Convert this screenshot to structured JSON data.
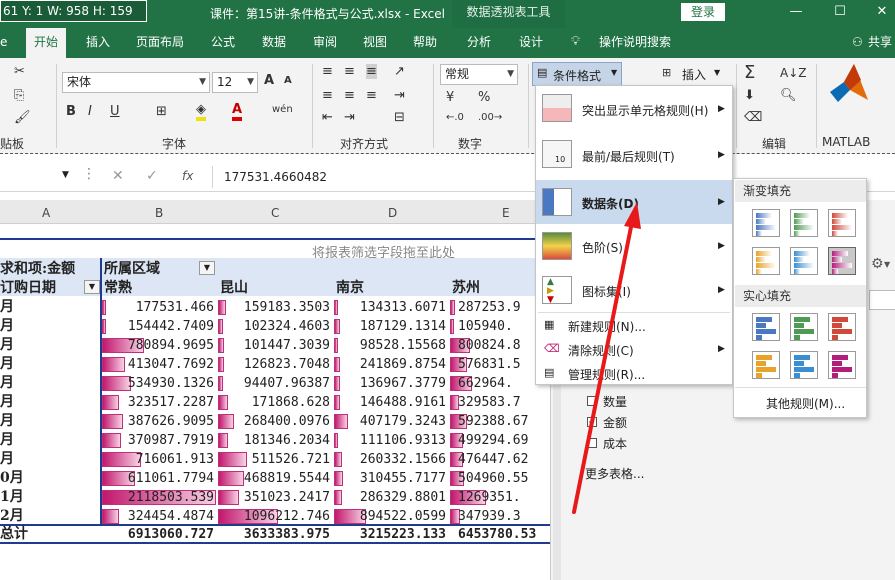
{
  "titlebar": {
    "coords": "61 Y: 1 W: 958 H: 159",
    "doc_title": "课件：第15讲-条件格式与公式.xlsx  -  Excel",
    "context_tools": "数据透视表工具",
    "login": "登录",
    "minimize": "—",
    "restore": "☐",
    "close": "✕"
  },
  "tabs": [
    "e",
    "开始",
    "插入",
    "页面布局",
    "公式",
    "数据",
    "审阅",
    "视图",
    "帮助",
    "分析",
    "设计",
    "操作说明搜索",
    "共享"
  ],
  "ribbon": {
    "font_name": "宋体",
    "font_size": "12",
    "number_format": "常规",
    "cond_format": "条件格式",
    "insert": "插入",
    "groups": [
      "贴板",
      "字体",
      "对齐方式",
      "数字",
      "编辑",
      "MATLAB"
    ],
    "bold": "B",
    "italic": "I",
    "underline": "U",
    "increase_font": "A",
    "decrease_font": "A",
    "wen": "wén",
    "percent": "%",
    "sum": "Σ",
    "matlab_label": "MATLAB"
  },
  "formula_bar": {
    "fx": "fx",
    "value": "177531.4660482"
  },
  "columns": [
    "A",
    "B",
    "C",
    "D",
    "E"
  ],
  "pivot": {
    "drop_hint": "将报表筛选字段拖至此处",
    "value_label": "求和项:金额",
    "col_field": "所属区域",
    "row_field": "订购日期",
    "regions": [
      "常熟",
      "昆山",
      "南京",
      "苏州"
    ],
    "rows": [
      {
        "label": "月",
        "values": [
          "177531.466",
          "159183.3503",
          "134313.6071",
          "287253.9"
        ]
      },
      {
        "label": "月",
        "values": [
          "154442.7409",
          "102324.4603",
          "187129.1314",
          "105940."
        ]
      },
      {
        "label": "月",
        "values": [
          "780894.9695",
          "101447.3039",
          "98528.15568",
          "800824.8"
        ]
      },
      {
        "label": "月",
        "values": [
          "413047.7692",
          "126823.7048",
          "241869.8754",
          "576831.5"
        ]
      },
      {
        "label": "月",
        "values": [
          "534930.1326",
          "94407.96387",
          "136967.3779",
          "662964."
        ]
      },
      {
        "label": "月",
        "values": [
          "323517.2287",
          "171868.628",
          "146488.9161",
          "329583.7"
        ]
      },
      {
        "label": "月",
        "values": [
          "387626.9095",
          "268400.0976",
          "407179.3243",
          "592388.67"
        ]
      },
      {
        "label": "月",
        "values": [
          "370987.7919",
          "181346.2034",
          "111106.9313",
          "499294.69"
        ]
      },
      {
        "label": "月",
        "values": [
          "716061.913",
          "511526.721",
          "260332.1566",
          "476447.62"
        ]
      },
      {
        "label": "0月",
        "values": [
          "611061.7794",
          "468819.5544",
          "310455.7177",
          "504960.55"
        ]
      },
      {
        "label": "1月",
        "values": [
          "2118503.539",
          "351023.2417",
          "286329.8801",
          "1269351."
        ]
      },
      {
        "label": "2月",
        "values": [
          "324454.4874",
          "1096212.746",
          "894522.0599",
          "347939.3"
        ]
      }
    ],
    "total_label": "总计",
    "totals": [
      "6913060.727",
      "3633383.975",
      "3215223.133",
      "6453780.53"
    ],
    "bar_levels": [
      [
        0.03,
        0.07,
        0.03,
        0.05
      ],
      [
        0.03,
        0.04,
        0.05,
        0.03
      ],
      [
        0.37,
        0.05,
        0.03,
        0.2
      ],
      [
        0.2,
        0.05,
        0.05,
        0.17
      ],
      [
        0.25,
        0.04,
        0.05,
        0.22
      ],
      [
        0.15,
        0.09,
        0.05,
        0.09
      ],
      [
        0.18,
        0.14,
        0.12,
        0.17
      ],
      [
        0.17,
        0.09,
        0.03,
        0.13
      ],
      [
        0.34,
        0.25,
        0.07,
        0.13
      ],
      [
        0.29,
        0.23,
        0.08,
        0.14
      ],
      [
        1.0,
        0.18,
        0.07,
        0.37
      ],
      [
        0.15,
        0.53,
        0.28,
        0.1
      ]
    ]
  },
  "fields_pane": {
    "fields": [
      "数量",
      "金额",
      "成本"
    ],
    "checked": [
      false,
      true,
      false
    ],
    "more": "更多表格..."
  },
  "cond_menu": {
    "items": [
      {
        "label": "突出显示单元格规则(H)",
        "arrow": true
      },
      {
        "label": "最前/最后规则(T)",
        "arrow": true
      },
      {
        "label": "数据条(D)",
        "arrow": true
      },
      {
        "label": "色阶(S)",
        "arrow": true
      },
      {
        "label": "图标集(I)",
        "arrow": true
      },
      {
        "label": "新建规则(N)...",
        "arrow": false
      },
      {
        "label": "清除规则(C)",
        "arrow": true
      },
      {
        "label": "管理规则(R)...",
        "arrow": false
      }
    ]
  },
  "databar_submenu": {
    "gradient_title": "渐变填充",
    "solid_title": "实心填充",
    "more_rules": "其他规则(M)..."
  },
  "colors": {
    "excel_green": "#217346",
    "bar_magenta": "#c2186d",
    "arrow_red": "#e8191a",
    "selected_menu": "#c9d9ee"
  }
}
